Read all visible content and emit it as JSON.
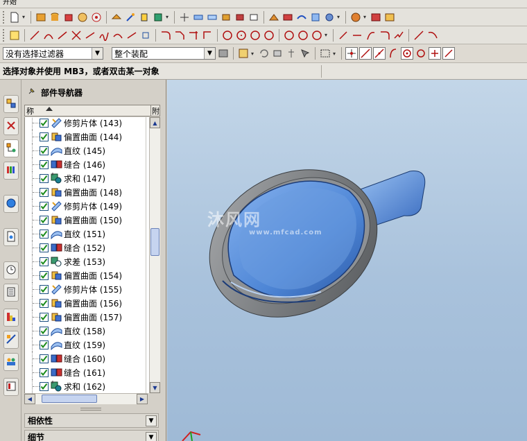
{
  "menu": {
    "start_label": "开始"
  },
  "filters": {
    "selection_filter": "没有选择过滤器",
    "assembly_scope": "整个装配"
  },
  "status": {
    "prompt": "选择对象并使用 MB3，或者双击某一对象"
  },
  "navigator": {
    "title": "部件导航器",
    "column_name": "称",
    "column_right": "附",
    "rows": [
      {
        "label": "修剪片体 (143)",
        "type": "trim"
      },
      {
        "label": "偏置曲面 (144)",
        "type": "offset"
      },
      {
        "label": "直纹 (145)",
        "type": "ruled"
      },
      {
        "label": "缝合 (146)",
        "type": "sew"
      },
      {
        "label": "求和 (147)",
        "type": "unite"
      },
      {
        "label": "偏置曲面 (148)",
        "type": "offset"
      },
      {
        "label": "修剪片体 (149)",
        "type": "trim"
      },
      {
        "label": "偏置曲面 (150)",
        "type": "offset"
      },
      {
        "label": "直纹 (151)",
        "type": "ruled"
      },
      {
        "label": "缝合 (152)",
        "type": "sew"
      },
      {
        "label": "求差 (153)",
        "type": "subtract"
      },
      {
        "label": "偏置曲面 (154)",
        "type": "offset"
      },
      {
        "label": "修剪片体 (155)",
        "type": "trim"
      },
      {
        "label": "偏置曲面 (156)",
        "type": "offset"
      },
      {
        "label": "偏置曲面 (157)",
        "type": "offset"
      },
      {
        "label": "直纹 (158)",
        "type": "ruled"
      },
      {
        "label": "直纹 (159)",
        "type": "ruled"
      },
      {
        "label": "缝合 (160)",
        "type": "sew"
      },
      {
        "label": "缝合 (161)",
        "type": "sew"
      },
      {
        "label": "求和 (162)",
        "type": "unite"
      }
    ],
    "sections": {
      "dependencies": "相依性",
      "details": "细节"
    }
  },
  "viewport": {
    "watermark_main": "沐风网",
    "watermark_sub": "www.mfcad.com"
  },
  "colors": {
    "accent": "#2a6fd6",
    "viewport_bg": "#b4cbe2",
    "model_shell": "#8a8d90",
    "model_face": "#5b8fd8"
  }
}
